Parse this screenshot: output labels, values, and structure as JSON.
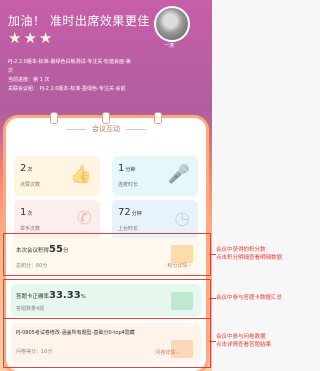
{
  "header": {
    "headline": "加油！ 准时出席效果更佳",
    "stars": [
      "★",
      "★",
      "★"
    ],
    "avatar_icon": "avatar-photo-icon",
    "user_name": "一涛"
  },
  "info": {
    "lines": [
      "PJ-2.2.0版本-标准-最绿色白板测试-专注关-轮值会面-第",
      "次",
      "当前进度：第 1 次",
      "关联会议组： PJ-2.2.0版本-标准-墨绿色-专注关-会前"
    ]
  },
  "card": {
    "title": "会议互动",
    "stats": [
      {
        "value": "2",
        "unit": "次",
        "label": "点赞次数",
        "icon": "thumbs-up-icon"
      },
      {
        "value": "1",
        "unit": "分钟",
        "label": "连麦时长",
        "icon": "microphone-icon"
      },
      {
        "value": "1",
        "unit": "次",
        "label": "举手次数",
        "icon": "phone-icon"
      },
      {
        "value": "72",
        "unit": "分钟",
        "label": "上台时长",
        "icon": "clock-icon"
      }
    ],
    "score": {
      "prefix": "本次会议积得",
      "value": "55",
      "unit": "分",
      "sub": "总积分：60分",
      "link": "积分详情 ›"
    },
    "quiz": {
      "prefix": "答题卡正确率",
      "value": "33.33",
      "unit": "%",
      "sub": "答题数量4题"
    },
    "survey": {
      "title": "PJ-0805考试卷修改-涵盖所有题型-基础分0-top4隐藏",
      "sub": "问卷得分：10分",
      "link": "问卷详情 ›"
    }
  },
  "annotations": [
    {
      "lines": [
        "会议中获得的积分数",
        "点击积分明细查看明细数据"
      ]
    },
    {
      "lines": [
        "会议中参与答题卡数据汇总"
      ]
    },
    {
      "lines": [
        "会议中参与问卷数据",
        "点击详情查看答题结果"
      ]
    }
  ],
  "colors": {
    "highlight": "#e5403a",
    "brand_orange": "#f08a6e",
    "header_purple": "#b15e9e"
  }
}
